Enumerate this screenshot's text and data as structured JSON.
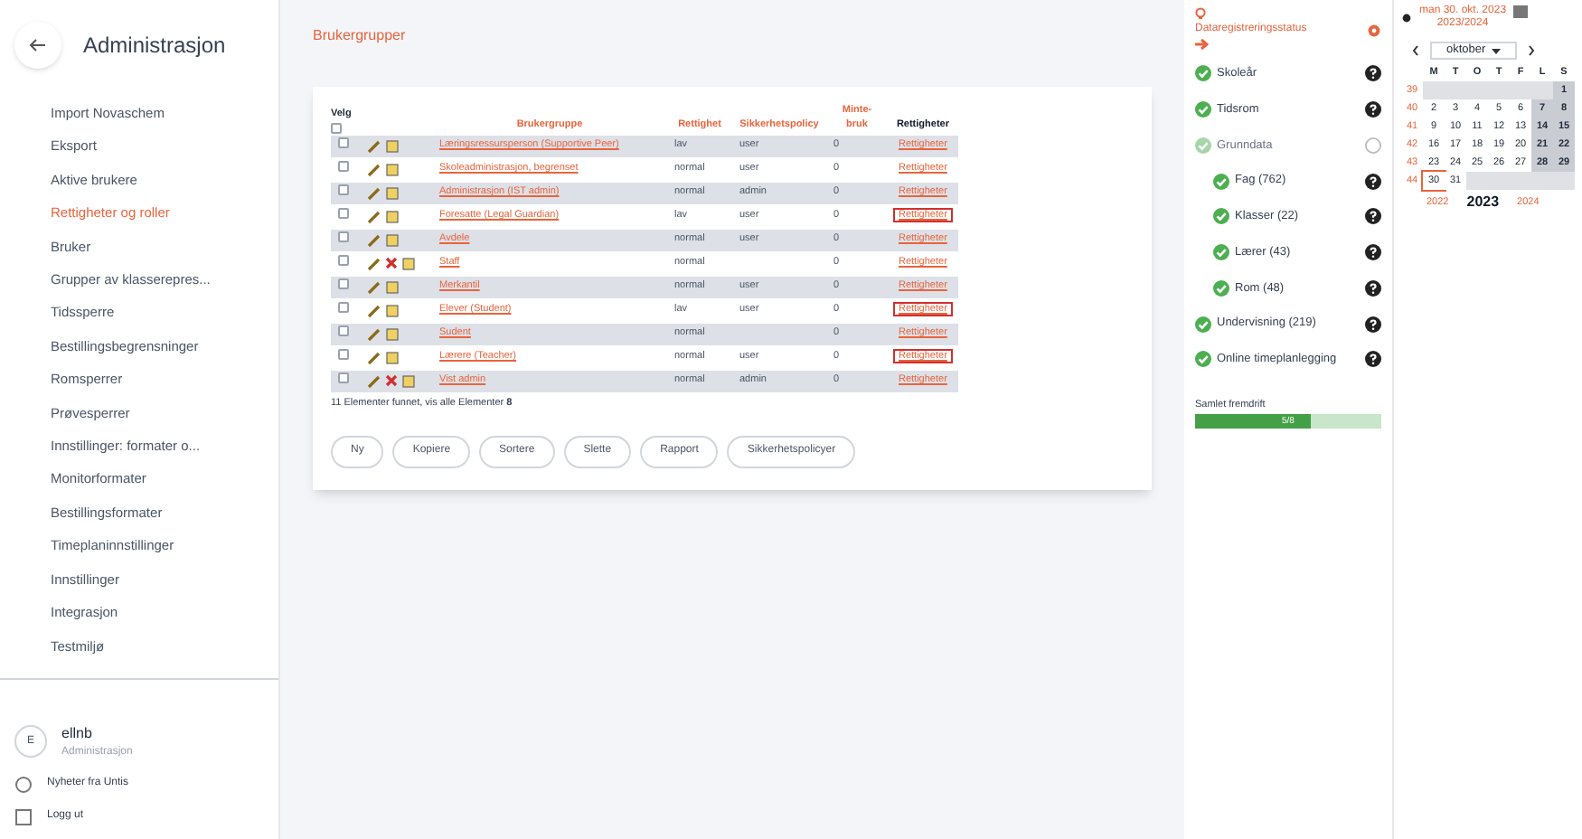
{
  "sidebar": {
    "title": "Administrasjon",
    "items": [
      {
        "label": "Import Novaschem",
        "selected": false
      },
      {
        "label": "Eksport",
        "selected": false
      },
      {
        "label": "Aktive brukere",
        "selected": false
      },
      {
        "label": "Rettigheter og roller",
        "selected": true
      },
      {
        "label": "Bruker",
        "selected": false
      },
      {
        "label": "Grupper av klasserepres...",
        "selected": false
      },
      {
        "label": "Tidssperre",
        "selected": false
      },
      {
        "label": "Bestillingsbegrensninger",
        "selected": false
      },
      {
        "label": "Romsperrer",
        "selected": false
      },
      {
        "label": "Prøvesperrer",
        "selected": false
      },
      {
        "label": "Innstillinger: formater o...",
        "selected": false
      },
      {
        "label": "Monitorformater",
        "selected": false
      },
      {
        "label": "Bestillingsformater",
        "selected": false
      },
      {
        "label": "Timeplaninnstillinger",
        "selected": false
      },
      {
        "label": "Innstillinger",
        "selected": false
      },
      {
        "label": "Integrasjon",
        "selected": false
      },
      {
        "label": "Testmiljø",
        "selected": false
      }
    ],
    "user": {
      "initial": "E",
      "name": "ellnb",
      "role": "Administrasjon"
    },
    "links": [
      "Nyheter fra Untis",
      "Logg ut"
    ]
  },
  "page_title": "Brukergrupper",
  "table": {
    "columns": [
      "Velg",
      "Brukergruppe",
      "Rettighet",
      "Sikkerhetspolicy",
      "Minte-bruk",
      "Rettigheter"
    ],
    "select_all_checked": false,
    "rows": [
      {
        "checked": false,
        "name": "Læringsressursperson (Supportive Peer)",
        "right": "lav",
        "policy": "user",
        "count": "0",
        "link": "Rettigheter",
        "deletable": false,
        "highlighted": false
      },
      {
        "checked": false,
        "name": "Skoleadministrasjon, begrenset",
        "right": "normal",
        "policy": "user",
        "count": "0",
        "link": "Rettigheter",
        "deletable": false,
        "highlighted": false
      },
      {
        "checked": false,
        "name": "Administrasjon (IST admin)",
        "right": "normal",
        "policy": "admin",
        "count": "0",
        "link": "Rettigheter",
        "deletable": false,
        "highlighted": false
      },
      {
        "checked": false,
        "name": "Foresatte (Legal Guardian)",
        "right": "lav",
        "policy": "user",
        "count": "0",
        "link": "Rettigheter",
        "deletable": false,
        "highlighted": true
      },
      {
        "checked": false,
        "name": "Avdele",
        "right": "normal",
        "policy": "user",
        "count": "0",
        "link": "Rettigheter",
        "deletable": false,
        "highlighted": false
      },
      {
        "checked": false,
        "name": "Staff",
        "right": "normal",
        "count": "0",
        "link": "Rettigheter",
        "deletable": true,
        "highlighted": false
      },
      {
        "checked": false,
        "name": "Merkantil",
        "right": "normal",
        "policy": "user",
        "count": "0",
        "link": "Rettigheter",
        "deletable": false,
        "highlighted": false
      },
      {
        "checked": false,
        "name": "Elever (Student)",
        "right": "lav",
        "policy": "user",
        "count": "0",
        "link": "Rettigheter",
        "deletable": false,
        "highlighted": true
      },
      {
        "checked": false,
        "name": "Sudent",
        "right": "normal",
        "count": "0",
        "link": "Rettigheter",
        "deletable": false,
        "highlighted": false
      },
      {
        "checked": false,
        "name": "Lærere (Teacher)",
        "right": "normal",
        "policy": "user",
        "count": "0",
        "link": "Rettigheter",
        "deletable": false,
        "highlighted": true
      },
      {
        "checked": false,
        "name": "Vist admin",
        "right": "normal",
        "policy": "admin",
        "count": "0",
        "link": "Rettigheter",
        "deletable": true,
        "highlighted": false
      }
    ],
    "footer_prefix": "11 Elementer funnet, vis alle Elementer",
    "footer_count": "8"
  },
  "buttons": [
    "Ny",
    "Kopiere",
    "Sortere",
    "Slette",
    "Rapport",
    "Sikkerhetspolicyer"
  ],
  "progress": {
    "title": "Dataregistreringsstatus",
    "items": [
      {
        "label": "Skoleår",
        "done": true
      },
      {
        "label": "Tidsrom",
        "done": true
      },
      {
        "label": "Grunndata",
        "done": false,
        "children": [
          {
            "label": "Fag (762)",
            "done": true
          },
          {
            "label": "Klasser (22)",
            "done": true
          },
          {
            "label": "Lærer (43)",
            "done": true
          },
          {
            "label": "Rom (48)",
            "done": true
          }
        ]
      },
      {
        "label": "Undervisning (219)",
        "done": true
      },
      {
        "label": "Online timeplanlegging",
        "done": true
      }
    ],
    "total_label": "Samlet fremdrift",
    "total_text": "5/8",
    "level": 0.625
  },
  "calendar": {
    "date": "man 30. okt. 2023",
    "school_year": "2023/2024",
    "month": "oktober",
    "weekdays": [
      "M",
      "T",
      "O",
      "T",
      "F",
      "L",
      "S"
    ],
    "weeks": [
      {
        "week": "39",
        "days": [
          {
            "kind": "outside"
          },
          {
            "kind": "outside"
          },
          {
            "kind": "outside"
          },
          {
            "kind": "outside"
          },
          {
            "kind": "outside"
          },
          {
            "kind": "outside"
          },
          {
            "day": "1",
            "kind": "weekend"
          }
        ]
      },
      {
        "week": "40",
        "days": [
          {
            "day": "2",
            "kind": "weekday"
          },
          {
            "day": "3",
            "kind": "weekday"
          },
          {
            "day": "4",
            "kind": "weekday"
          },
          {
            "day": "5",
            "kind": "weekday"
          },
          {
            "day": "6",
            "kind": "weekday"
          },
          {
            "day": "7",
            "kind": "weekend"
          },
          {
            "day": "8",
            "kind": "weekend"
          }
        ]
      },
      {
        "week": "41",
        "days": [
          {
            "day": "9",
            "kind": "weekday"
          },
          {
            "day": "10",
            "kind": "weekday"
          },
          {
            "day": "11",
            "kind": "weekday"
          },
          {
            "day": "12",
            "kind": "weekday"
          },
          {
            "day": "13",
            "kind": "weekday"
          },
          {
            "day": "14",
            "kind": "weekend"
          },
          {
            "day": "15",
            "kind": "weekend"
          }
        ]
      },
      {
        "week": "42",
        "days": [
          {
            "day": "16",
            "kind": "weekday"
          },
          {
            "day": "17",
            "kind": "weekday"
          },
          {
            "day": "18",
            "kind": "weekday"
          },
          {
            "day": "19",
            "kind": "weekday"
          },
          {
            "day": "20",
            "kind": "weekday"
          },
          {
            "day": "21",
            "kind": "weekend"
          },
          {
            "day": "22",
            "kind": "weekend"
          }
        ]
      },
      {
        "week": "43",
        "days": [
          {
            "day": "23",
            "kind": "weekday"
          },
          {
            "day": "24",
            "kind": "weekday"
          },
          {
            "day": "25",
            "kind": "weekday"
          },
          {
            "day": "26",
            "kind": "weekday"
          },
          {
            "day": "27",
            "kind": "weekday"
          },
          {
            "day": "28",
            "kind": "weekend"
          },
          {
            "day": "29",
            "kind": "weekend"
          }
        ]
      },
      {
        "week": "44",
        "days": [
          {
            "day": "30",
            "kind": "today"
          },
          {
            "day": "31",
            "kind": "weekday"
          },
          {
            "kind": "outside"
          },
          {
            "kind": "outside"
          },
          {
            "kind": "outside"
          },
          {
            "kind": "outside"
          },
          {
            "kind": "outside"
          }
        ]
      }
    ],
    "years": [
      {
        "label": "2022",
        "selected": false
      },
      {
        "label": "2023",
        "selected": true
      },
      {
        "label": "2024",
        "selected": false
      }
    ]
  }
}
